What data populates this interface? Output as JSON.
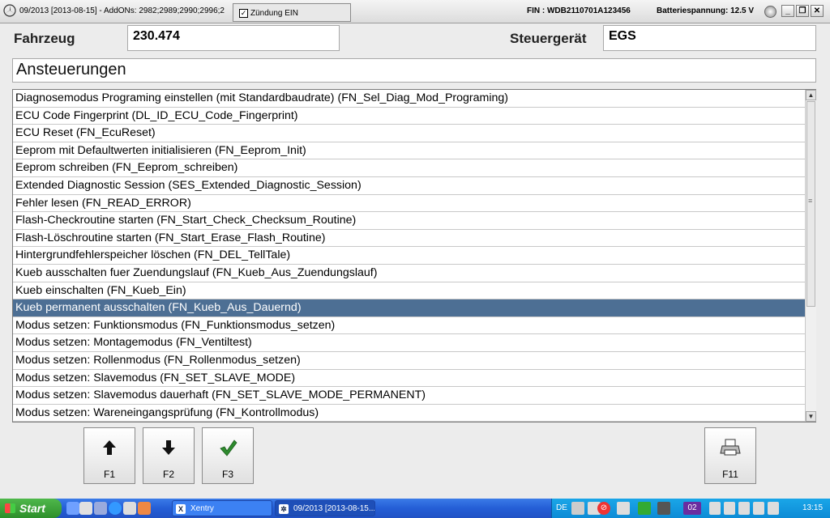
{
  "titlebar": {
    "title": "09/2013 [2013-08-15] - AddONs: 2982;2989;2990;2996;2",
    "popup_label": "Zündung EIN",
    "popup_checked": true,
    "fin": "FIN : WDB2110701A123456",
    "battery": "Batteriespannung: 12.5 V",
    "min_label": "_",
    "restore_label": "❐",
    "close_label": "✕"
  },
  "header": {
    "vehicle_label": "Fahrzeug",
    "vehicle_value": "230.474",
    "ecu_label": "Steuergerät",
    "ecu_value": "EGS",
    "section_title": "Ansteuerungen"
  },
  "list": {
    "selected_index": 12,
    "items": [
      "Diagnosemodus Programing einstellen (mit Standardbaudrate) (FN_Sel_Diag_Mod_Programing)",
      "ECU Code Fingerprint (DL_ID_ECU_Code_Fingerprint)",
      "ECU Reset (FN_EcuReset)",
      "Eeprom mit Defaultwerten initialisieren (FN_Eeprom_Init)",
      "Eeprom schreiben (FN_Eeprom_schreiben)",
      "Extended Diagnostic Session (SES_Extended_Diagnostic_Session)",
      "Fehler lesen (FN_READ_ERROR)",
      "Flash-Checkroutine starten (FN_Start_Check_Checksum_Routine)",
      "Flash-Löschroutine starten (FN_Start_Erase_Flash_Routine)",
      "Hintergrundfehlerspeicher löschen (FN_DEL_TellTale)",
      "Kueb ausschalten fuer Zuendungslauf (FN_Kueb_Aus_Zuendungslauf)",
      "Kueb einschalten (FN_Kueb_Ein)",
      "Kueb permanent ausschalten (FN_Kueb_Aus_Dauernd)",
      "Modus setzen: Funktionsmodus (FN_Funktionsmodus_setzen)",
      "Modus setzen: Montagemodus (FN_Ventiltest)",
      "Modus setzen: Rollenmodus (FN_Rollenmodus_setzen)",
      "Modus setzen: Slavemodus (FN_SET_SLAVE_MODE)",
      "Modus setzen: Slavemodus dauerhaft (FN_SET_SLAVE_MODE_PERMANENT)",
      "Modus setzen: Wareneingangsprüfung (FN_Kontrollmodus)"
    ]
  },
  "buttons": {
    "f1": {
      "icon": "arrow-up-icon",
      "label": "F1"
    },
    "f2": {
      "icon": "arrow-down-icon",
      "label": "F2"
    },
    "f3": {
      "icon": "checkmark-icon",
      "label": "F3"
    },
    "f11": {
      "icon": "printer-icon",
      "label": "F11"
    }
  },
  "taskbar": {
    "start_label": "Start",
    "tasks": [
      {
        "label": "Xentry"
      },
      {
        "label": "09/2013 [2013-08-15..."
      }
    ],
    "lang": "DE",
    "tray_badge": "02",
    "clock": "13:15"
  },
  "colors": {
    "selection": "#4d6f94",
    "taskbar": "#245ed6",
    "start": "#3a9b36",
    "checkmark": "#2e8b2e"
  }
}
